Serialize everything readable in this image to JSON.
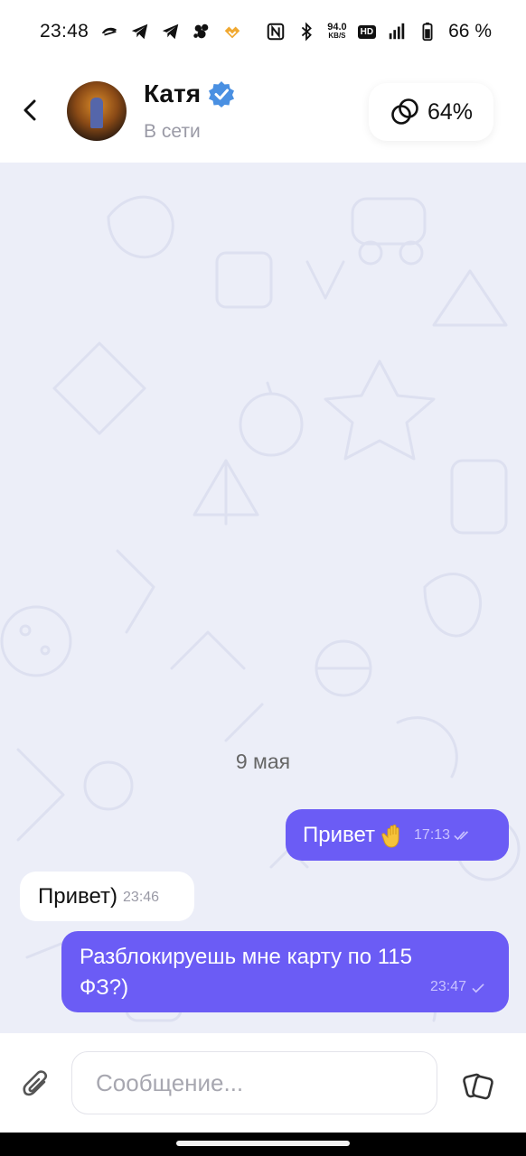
{
  "status_bar": {
    "time": "23:48",
    "net_speed_value": "94.0",
    "net_speed_unit": "KB/S",
    "hd_label": "HD",
    "battery_percent": "66 %",
    "icons": [
      "app-notification-icon",
      "telegram-icon",
      "telegram-icon",
      "app-notification-icon",
      "app-notification-icon",
      "nfc-icon",
      "bluetooth-icon",
      "signal-icon",
      "battery-icon"
    ]
  },
  "header": {
    "contact_name": "Катя",
    "contact_status": "В сети",
    "connection_percent": "64%",
    "icons": {
      "back": "chevron-left-icon",
      "verified": "verified-badge-icon",
      "connection": "rings-icon"
    }
  },
  "chat": {
    "date_divider": "9 мая",
    "messages": [
      {
        "direction": "outgoing",
        "text": "Привет",
        "emoji": "waving-hand",
        "time": "17:13",
        "status": "read"
      },
      {
        "direction": "incoming",
        "text": "Привет)",
        "time": "23:46"
      },
      {
        "direction": "outgoing",
        "text": "Разблокируешь мне карту по 115 ФЗ?)",
        "time": "23:47",
        "status": "sent"
      }
    ]
  },
  "composer": {
    "placeholder": "Сообщение...",
    "icons": {
      "attach": "paperclip-icon",
      "sticker": "sticker-icon"
    }
  },
  "colors": {
    "accent": "#6b5cf5",
    "chat_background": "#eceef8",
    "incoming_bubble": "#ffffff",
    "verified": "#4a90e2"
  }
}
